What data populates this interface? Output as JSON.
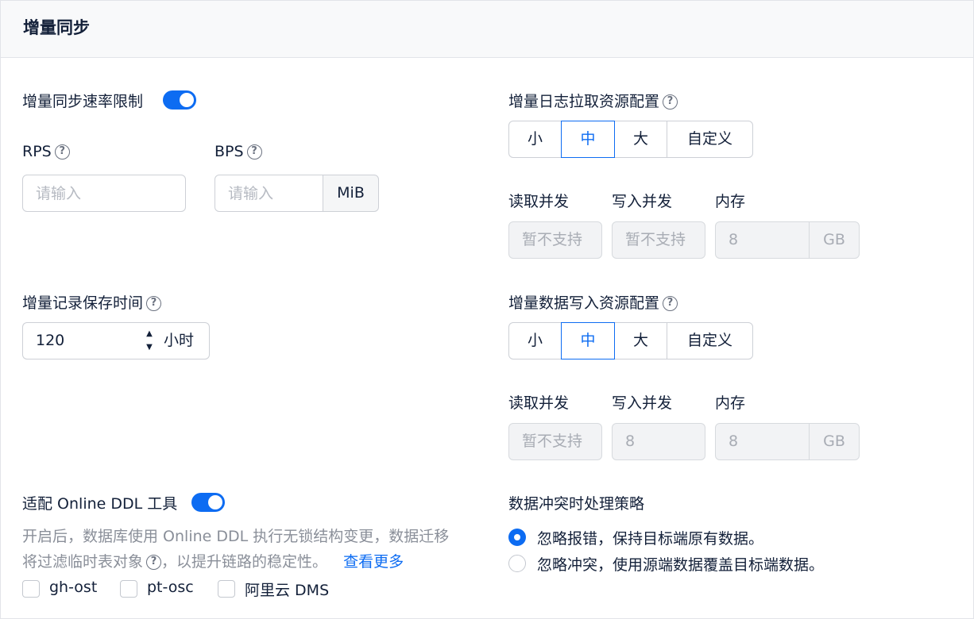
{
  "header": {
    "title": "增量同步"
  },
  "rate_limit": {
    "label": "增量同步速率限制",
    "rps_label": "RPS",
    "rps_placeholder": "请输入",
    "bps_label": "BPS",
    "bps_placeholder": "请输入",
    "bps_unit": "MiB"
  },
  "retention": {
    "label": "增量记录保存时间",
    "value": "120",
    "unit": "小时"
  },
  "online_ddl": {
    "label": "适配 Online DDL 工具",
    "desc_line1": "开启后，数据库使用 Online DDL 执行无锁结构变更，数据迁移",
    "desc_line2": "将过滤临时表对象",
    "desc_line2b": "，以提升链路的稳定性。",
    "more_link": "查看更多",
    "tools": [
      "gh-ost",
      "pt-osc",
      "阿里云 DMS"
    ]
  },
  "log_pull": {
    "label": "增量日志拉取资源配置",
    "options": [
      "小",
      "中",
      "大",
      "自定义"
    ],
    "selected": "中",
    "read_label": "读取并发",
    "write_label": "写入并发",
    "memory_label": "内存",
    "read_value": "暂不支持",
    "write_value": "暂不支持",
    "memory_value": "8",
    "memory_unit": "GB"
  },
  "data_write": {
    "label": "增量数据写入资源配置",
    "options": [
      "小",
      "中",
      "大",
      "自定义"
    ],
    "selected": "中",
    "read_label": "读取并发",
    "write_label": "写入并发",
    "memory_label": "内存",
    "read_value": "暂不支持",
    "write_value": "8",
    "memory_value": "8",
    "memory_unit": "GB"
  },
  "conflict": {
    "label": "数据冲突时处理策略",
    "options": [
      "忽略报错，保持目标端原有数据。",
      "忽略冲突，使用源端数据覆盖目标端数据。"
    ],
    "selected_index": 0
  },
  "icons": {
    "help": "?",
    "up": "▲",
    "down": "▼"
  },
  "colors": {
    "accent": "#0d6cf2"
  }
}
